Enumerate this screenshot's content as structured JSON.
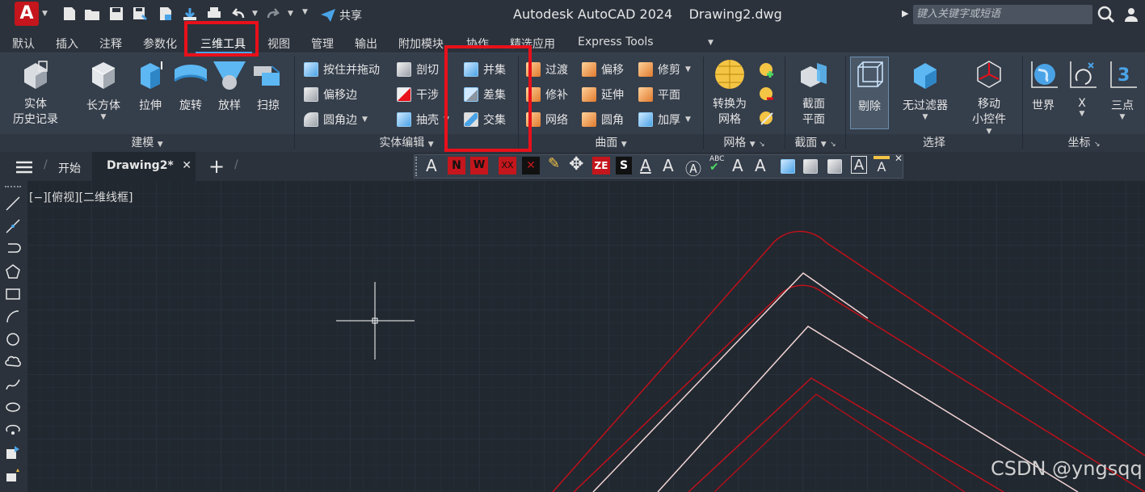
{
  "app": {
    "logo_letter": "A",
    "title": "Autodesk AutoCAD 2024",
    "file": "Drawing2.dwg",
    "share": "共享",
    "search_placeholder": "键入关键字或短语"
  },
  "ribbon_tabs": [
    "默认",
    "插入",
    "注释",
    "参数化",
    "三维工具",
    "视图",
    "管理",
    "输出",
    "附加模块",
    "协作",
    "精选应用",
    "Express Tools"
  ],
  "panels": {
    "modeling": {
      "title": "建模",
      "history": "实体\n历史记录",
      "box": "长方体",
      "extrude": "拉伸",
      "revolve": "旋转",
      "loft": "放样",
      "sweep": "扫掠"
    },
    "solid_edit": {
      "title": "实体编辑",
      "presspull": "按住并拖动",
      "offset_edge": "偏移边",
      "fillet_edge": "圆角边",
      "slice": "剖切",
      "interfere": "干涉",
      "shell": "抽壳",
      "union": "并集",
      "subtract": "差集",
      "intersect": "交集"
    },
    "surface": {
      "title": "曲面",
      "blend": "过渡",
      "patch": "修补",
      "network": "网络",
      "offset": "偏移",
      "extend": "延伸",
      "fillet": "圆角",
      "trim": "修剪",
      "planar": "平面",
      "thicken": "加厚"
    },
    "mesh": {
      "title": "网格",
      "convert": "转换为\n网格"
    },
    "section": {
      "title": "截面",
      "plane": "截面\n平面"
    },
    "selection": {
      "title": "选择",
      "cull": "剔除",
      "nofilter": "无过滤器",
      "gizmo": "移动\n小控件"
    },
    "ucs": {
      "title": "坐标",
      "world": "世界",
      "x": "X",
      "three": "三点",
      "three_num": "3"
    }
  },
  "doc_tabs": {
    "start": "开始",
    "active": "Drawing2*"
  },
  "viewport_label": "[−][俯视][二维线框]",
  "watermark": "CSDN @yngsqq",
  "colors": {
    "highlight": "#e8101a",
    "accent": "#4aa3e6"
  }
}
